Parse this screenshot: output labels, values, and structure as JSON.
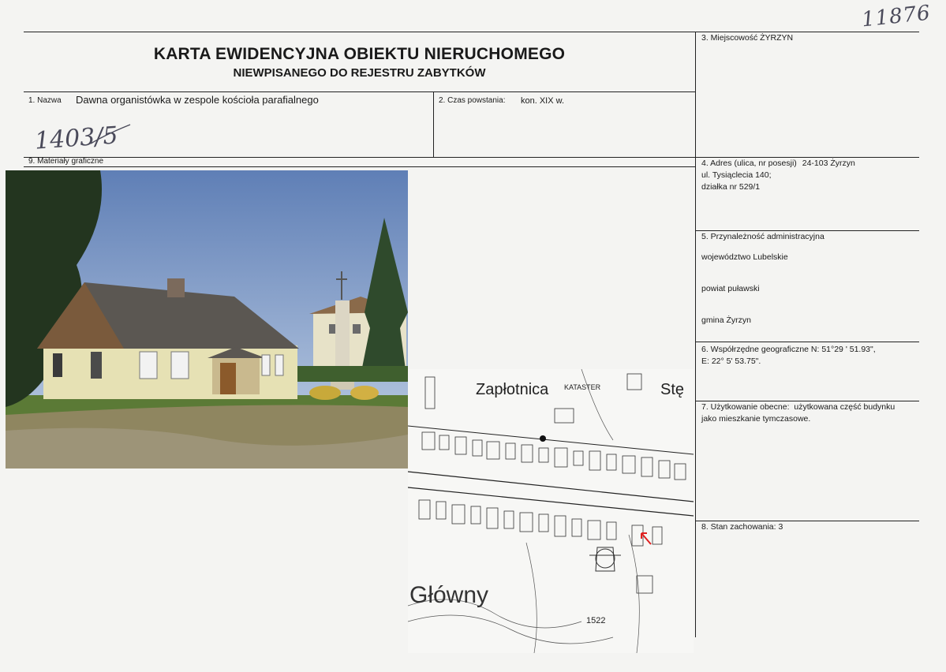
{
  "header": {
    "title": "KARTA EWIDENCYJNA OBIEKTU NIERUCHOMEGO",
    "subtitle": "NIEWPISANEGO DO REJESTRU ZABYTKÓW",
    "stamp_number": "11876",
    "handwritten_ref": "1403/5"
  },
  "fields": {
    "nazwa": {
      "label": "1. Nazwa",
      "value": "Dawna organistówka w zespole kościoła parafialnego"
    },
    "czas": {
      "label": "2. Czas powstania:",
      "value": "kon.  XIX w."
    },
    "miejscowosc": {
      "label": "3. Miejscowość",
      "value": "ŻYRZYN"
    },
    "adres": {
      "label": "4. Adres (ulica, nr posesji)",
      "line1": "24-103 Żyrzyn",
      "line2": "ul. Tysiąclecia 140;",
      "line3": "działka nr 529/1"
    },
    "przynaleznosc": {
      "label": "5. Przynależność administracyjna",
      "wojewodztwo": "województwo  Lubelskie",
      "powiat": "powiat puławski",
      "gmina": "gmina Żyrzyn"
    },
    "wspolrzedne": {
      "label": "6. Współrzędne geograficzne",
      "n": "N: 51°29 ' 51.93\",",
      "e": "E: 22° 5' 53.75\"."
    },
    "uzytkowanie": {
      "label": "7. Użytkowanie obecne:",
      "line1": "użytkowana część budynku",
      "line2": "jako mieszkanie tymczasowe."
    },
    "stan": {
      "label": "8. Stan zachowania:",
      "value": "3"
    },
    "materialy": {
      "label": "9. Materiały graficzne"
    }
  },
  "map": {
    "label_top": "Zapłotnica",
    "label_kataster": "KATASTER",
    "label_ste": "Stę",
    "label_bottom": "Główny",
    "label_num": "1522",
    "marker_color": "#e02020"
  }
}
